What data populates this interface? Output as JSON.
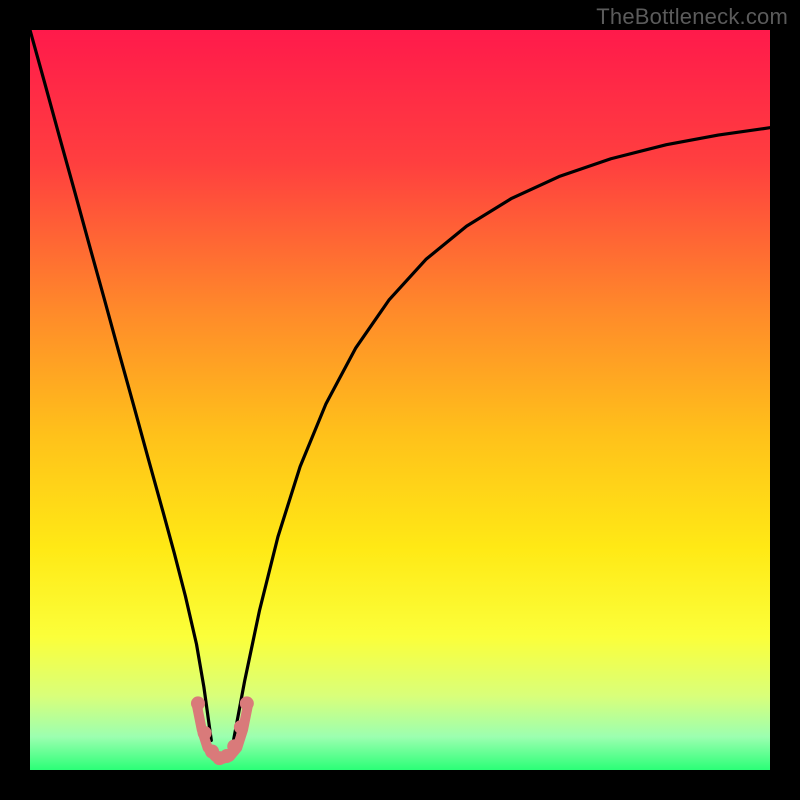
{
  "watermark": "TheBottleneck.com",
  "chart_data": {
    "type": "line",
    "title": "",
    "xlabel": "",
    "ylabel": "",
    "xlim": [
      0,
      100
    ],
    "ylim": [
      0,
      100
    ],
    "grid": false,
    "legend": false,
    "gradient_stops": [
      {
        "pos": 0.0,
        "color": "#ff1a4b"
      },
      {
        "pos": 0.18,
        "color": "#ff3f3f"
      },
      {
        "pos": 0.38,
        "color": "#ff8a2a"
      },
      {
        "pos": 0.55,
        "color": "#ffc21a"
      },
      {
        "pos": 0.7,
        "color": "#ffe915"
      },
      {
        "pos": 0.82,
        "color": "#fbff3a"
      },
      {
        "pos": 0.9,
        "color": "#d9ff7a"
      },
      {
        "pos": 0.955,
        "color": "#9cffb0"
      },
      {
        "pos": 1.0,
        "color": "#2bff77"
      }
    ],
    "series": [
      {
        "name": "left-arm",
        "color": "#000000",
        "x": [
          0.0,
          2.0,
          4.0,
          6.0,
          8.0,
          10.0,
          12.0,
          14.0,
          16.0,
          18.0,
          19.5,
          21.0,
          22.5,
          23.5,
          24.5
        ],
        "y": [
          100.0,
          92.8,
          85.5,
          78.3,
          71.0,
          63.8,
          56.5,
          49.3,
          42.0,
          34.8,
          29.3,
          23.5,
          17.0,
          11.2,
          4.0
        ]
      },
      {
        "name": "right-arm",
        "color": "#000000",
        "x": [
          27.5,
          29.0,
          31.0,
          33.5,
          36.5,
          40.0,
          44.0,
          48.5,
          53.5,
          59.0,
          65.0,
          71.5,
          78.5,
          86.0,
          93.0,
          100.0
        ],
        "y": [
          4.0,
          12.0,
          21.5,
          31.5,
          41.0,
          49.5,
          57.0,
          63.5,
          69.0,
          73.5,
          77.2,
          80.2,
          82.6,
          84.5,
          85.8,
          86.8
        ]
      },
      {
        "name": "valley-highlight",
        "color": "#d97a7a",
        "x": [
          22.5,
          23.2,
          24.0,
          25.0,
          26.0,
          27.0,
          28.0,
          28.8,
          29.5
        ],
        "y": [
          9.0,
          5.5,
          3.0,
          1.8,
          1.5,
          1.8,
          3.0,
          5.5,
          9.0
        ]
      }
    ],
    "valley_markers": {
      "color": "#d97a7a",
      "points": [
        {
          "x": 22.7,
          "y": 9.0
        },
        {
          "x": 23.6,
          "y": 5.0
        },
        {
          "x": 24.6,
          "y": 2.5
        },
        {
          "x": 25.6,
          "y": 1.6
        },
        {
          "x": 26.6,
          "y": 1.9
        },
        {
          "x": 27.6,
          "y": 3.2
        },
        {
          "x": 28.5,
          "y": 5.8
        },
        {
          "x": 29.3,
          "y": 9.0
        }
      ]
    }
  }
}
